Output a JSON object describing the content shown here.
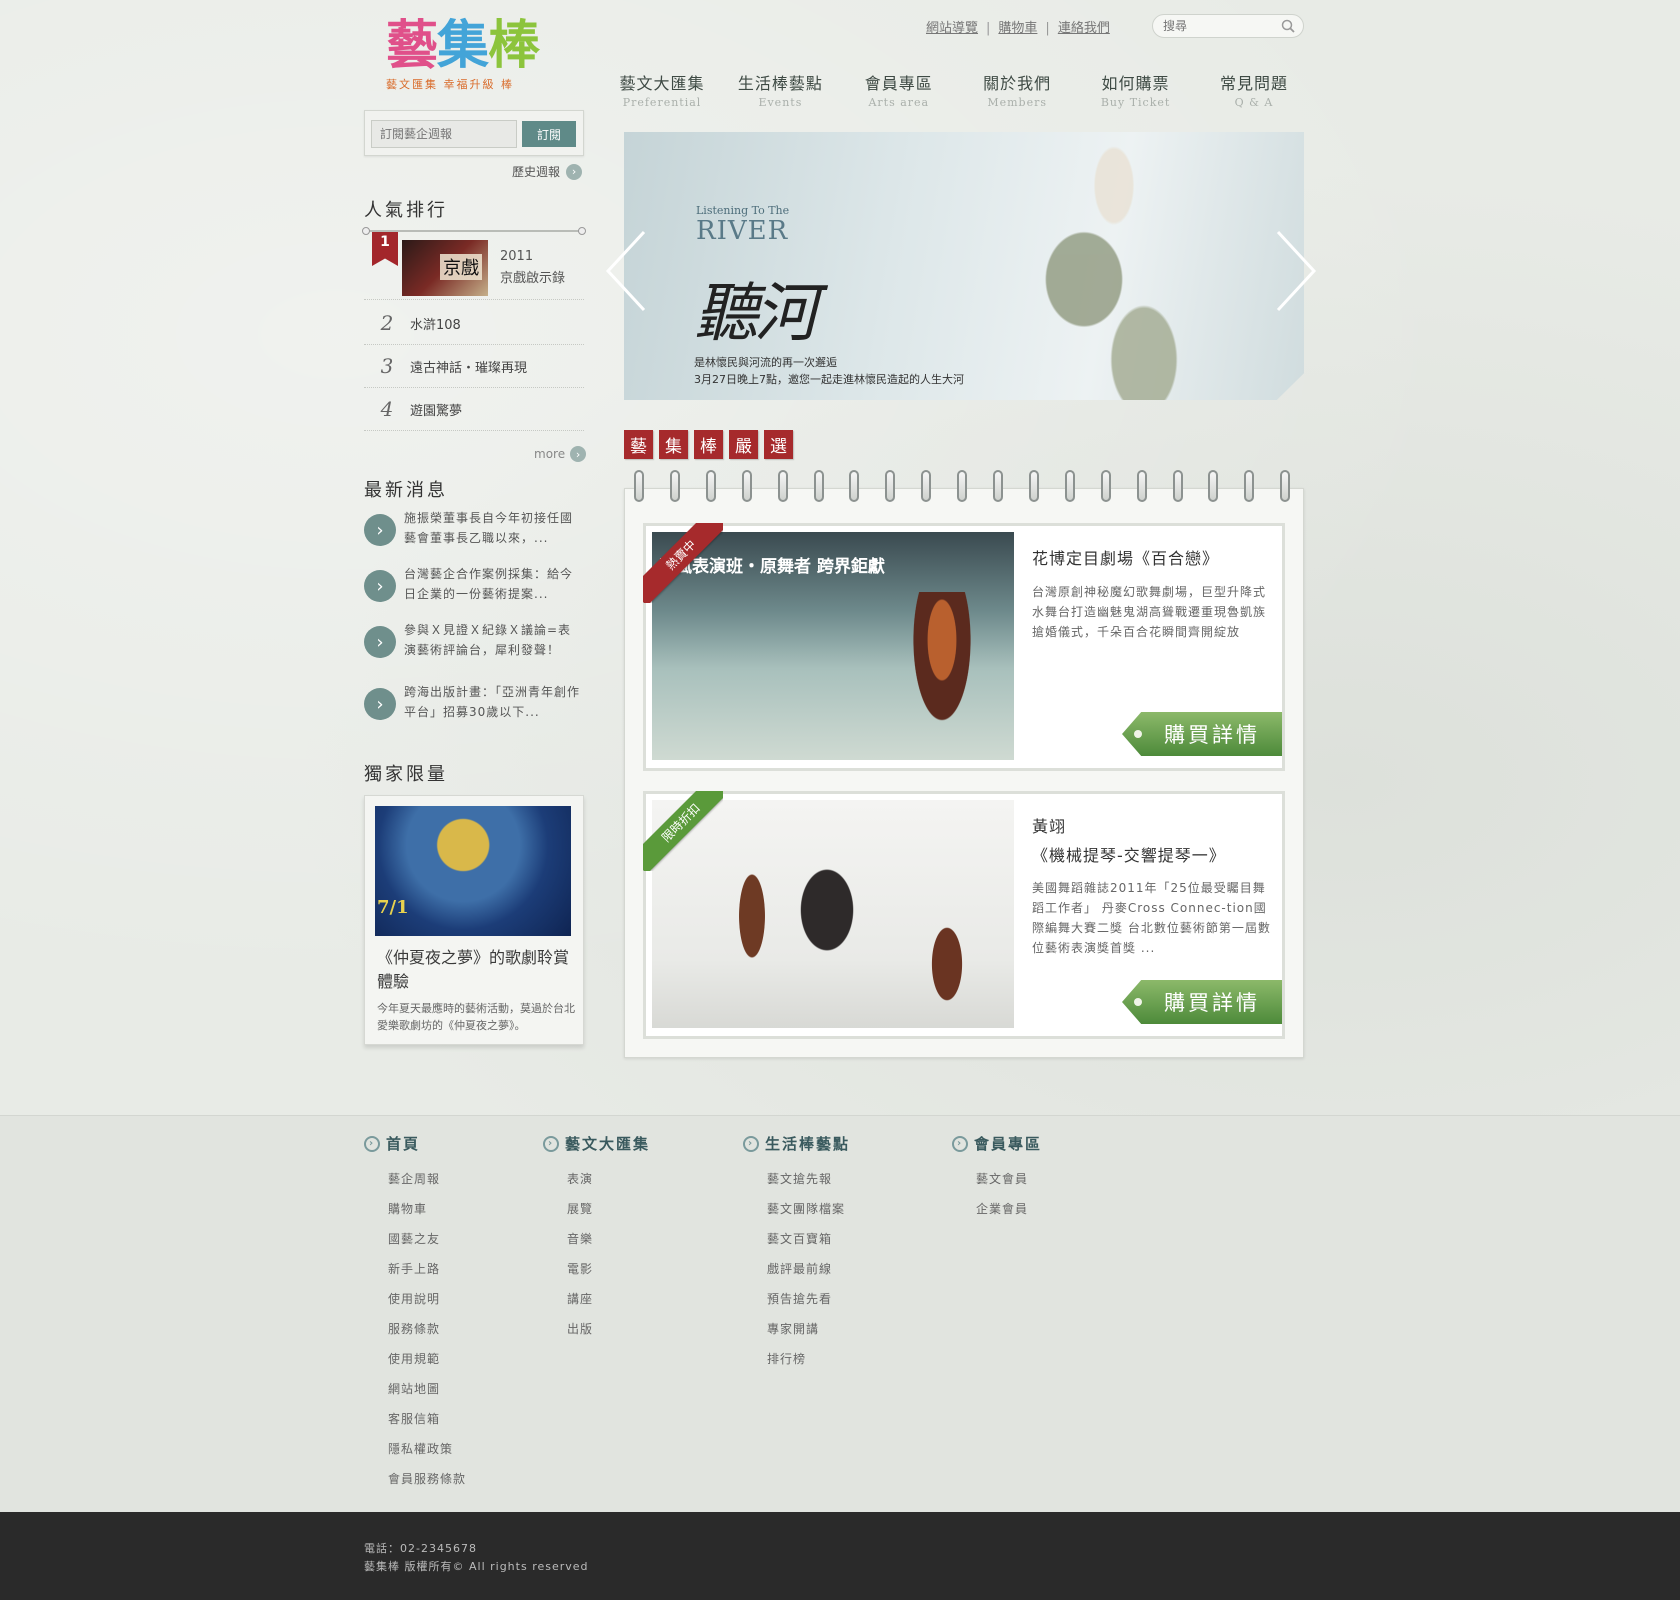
{
  "logo": {
    "text": [
      "藝",
      "集",
      "棒"
    ],
    "tagline": "藝文匯集 幸福升級  棒"
  },
  "top_links": [
    "網站導覽",
    "購物車",
    "連絡我們"
  ],
  "search": {
    "placeholder": "搜尋"
  },
  "main_nav": [
    {
      "zh": "藝文大匯集",
      "en": "Preferential"
    },
    {
      "zh": "生活棒藝點",
      "en": "Events"
    },
    {
      "zh": "會員專區",
      "en": "Arts area"
    },
    {
      "zh": "關於我們",
      "en": "Members"
    },
    {
      "zh": "如何購票",
      "en": "Buy Ticket"
    },
    {
      "zh": "常見問題",
      "en": "Q & A"
    }
  ],
  "subscribe": {
    "placeholder": "訂閱藝企週報",
    "button": "訂閱",
    "history": "歷史週報"
  },
  "ranking": {
    "title": "人氣排行",
    "top": {
      "rank": "1",
      "thumb_text": "京戲",
      "year": "2011",
      "title": "京戲啟示錄"
    },
    "items": [
      {
        "rank": "2",
        "title": "水滸108"
      },
      {
        "rank": "3",
        "title": "遠古神話・璀璨再現"
      },
      {
        "rank": "4",
        "title": "遊園驚夢"
      }
    ],
    "more": "more"
  },
  "news": {
    "title": "最新消息",
    "items": [
      "施振榮董事長自今年初接任國藝會董事長乙職以來，...",
      "台灣藝企合作案例採集：給今日企業的一份藝術提案...",
      "參與Ｘ見證Ｘ紀錄Ｘ議論=表演藝術評論台，犀利發聲！",
      "跨海出版計畫：「亞洲青年創作平台」招募30歲以下..."
    ]
  },
  "exclusive": {
    "title": "獨家限量",
    "date": "7/1",
    "item_title": "《仲夏夜之夢》的歌劇聆賞體驗",
    "item_desc": "今年夏天最應時的藝術活動，莫過於台北愛樂歌劇坊的《仲夏夜之夢》。"
  },
  "banner": {
    "en_small": "Listening To The",
    "en_big": "RIVER",
    "zh": "聽河",
    "caption1": "是林懷民與河流的再一次邂逅",
    "caption2": "3月27日晚上7點，邀您一起走進林懷民造起的人生大河"
  },
  "featured": {
    "badges": [
      "藝",
      "集",
      "棒",
      "嚴",
      "選"
    ],
    "cards": [
      {
        "tag": "熱賣中",
        "tag_color": "#a62a2c",
        "image_title": "屏風表演班・原舞者 跨界鉅獻",
        "title": "花博定目劇場《百合戀》",
        "subtitle": "",
        "desc": "台灣原創神秘魔幻歌舞劇場，巨型升降式水舞台打造幽魅鬼湖高聳戰遷重現魯凱族搶婚儀式，千朵百合花瞬間齊開綻放",
        "button": "購買詳情"
      },
      {
        "tag": "限時折扣",
        "tag_color": "#5a9a3a",
        "title": "黃翊",
        "subtitle": "《機械提琴-交響提琴一》",
        "desc": "美國舞蹈雜誌2011年「25位最受矚目舞蹈工作者」 丹麥Cross Connec-tion國際編舞大賽二獎 台北數位藝術節第一屆數位藝術表演獎首獎 ...",
        "button": "購買詳情"
      }
    ]
  },
  "footer_nav": [
    {
      "head": "首頁",
      "items": [
        "藝企周報",
        "購物車",
        "國藝之友",
        "新手上路",
        "使用說明",
        "服務條款",
        "使用規範",
        "網站地圖",
        "客服信箱",
        "隱私權政策",
        "會員服務條款"
      ]
    },
    {
      "head": "藝文大匯集",
      "items": [
        "表演",
        "展覽",
        "音樂",
        "電影",
        "講座",
        "出版"
      ]
    },
    {
      "head": "生活棒藝點",
      "items": [
        "藝文搶先報",
        "藝文團隊檔案",
        "藝文百寶箱",
        "戲評最前線",
        "預告搶先看",
        "專家開講",
        "排行榜"
      ]
    },
    {
      "head": "會員專區",
      "items": [
        "藝文會員",
        "企業會員"
      ]
    }
  ],
  "bottom": {
    "phone": "電話：02-2345678",
    "copyright": "藝集棒 版權所有© All rights reserved"
  }
}
